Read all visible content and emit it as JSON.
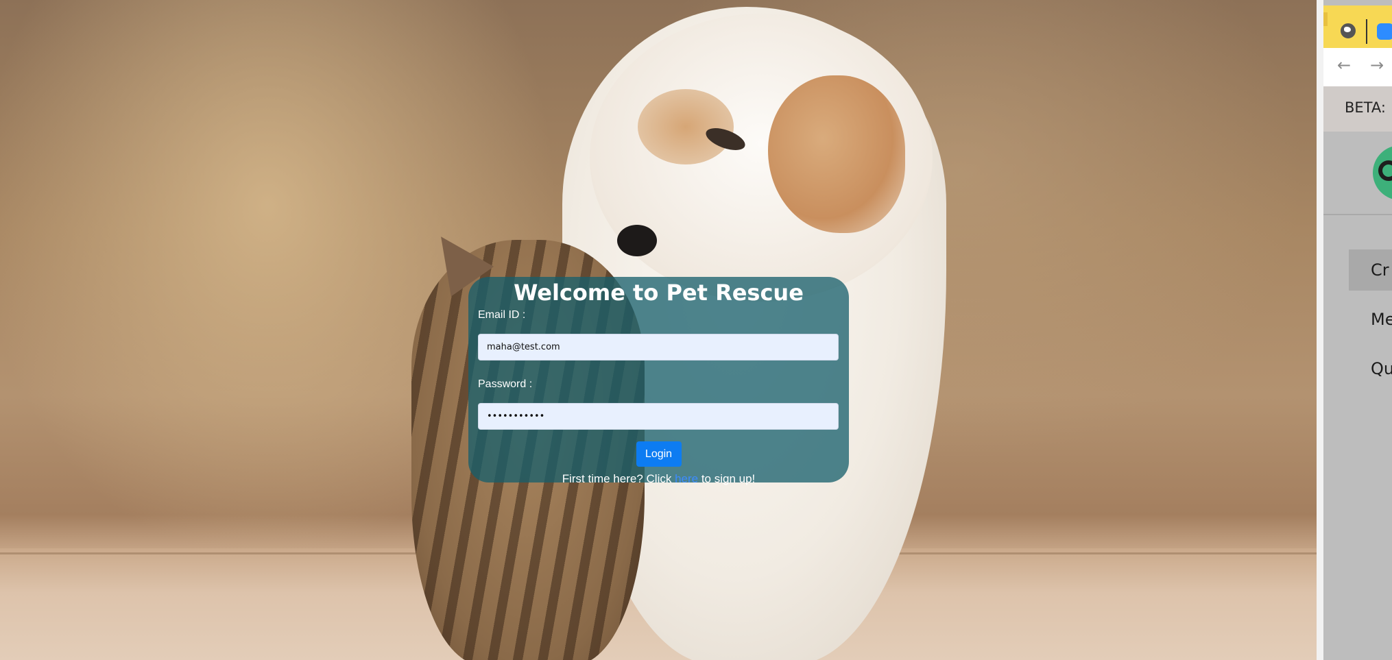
{
  "login": {
    "title": "Welcome to Pet Rescue",
    "email_label": "Email ID :",
    "email_value": "maha@test.com",
    "password_label": "Password :",
    "password_value": "maha@test12",
    "login_button": "Login",
    "signup_prefix": "First time here? Click ",
    "signup_link": "here",
    "signup_suffix": " to sign up!"
  },
  "background": {
    "image": "puppy-and-kitten-photo"
  },
  "side_panel": {
    "beta_text": "BETA: ",
    "icons": [
      "globe-icon",
      "video-icon",
      "back-arrow-icon",
      "forward-arrow-icon",
      "app-logo-icon"
    ],
    "nav_back": "←",
    "nav_forward": "→",
    "menu": [
      {
        "label": "Cr"
      },
      {
        "label": "Me"
      },
      {
        "label": "Qu"
      }
    ]
  },
  "colors": {
    "card": "#165f6c",
    "button": "#0d7cf2",
    "link": "#3d8cff",
    "panel_top": "#f7d854"
  }
}
